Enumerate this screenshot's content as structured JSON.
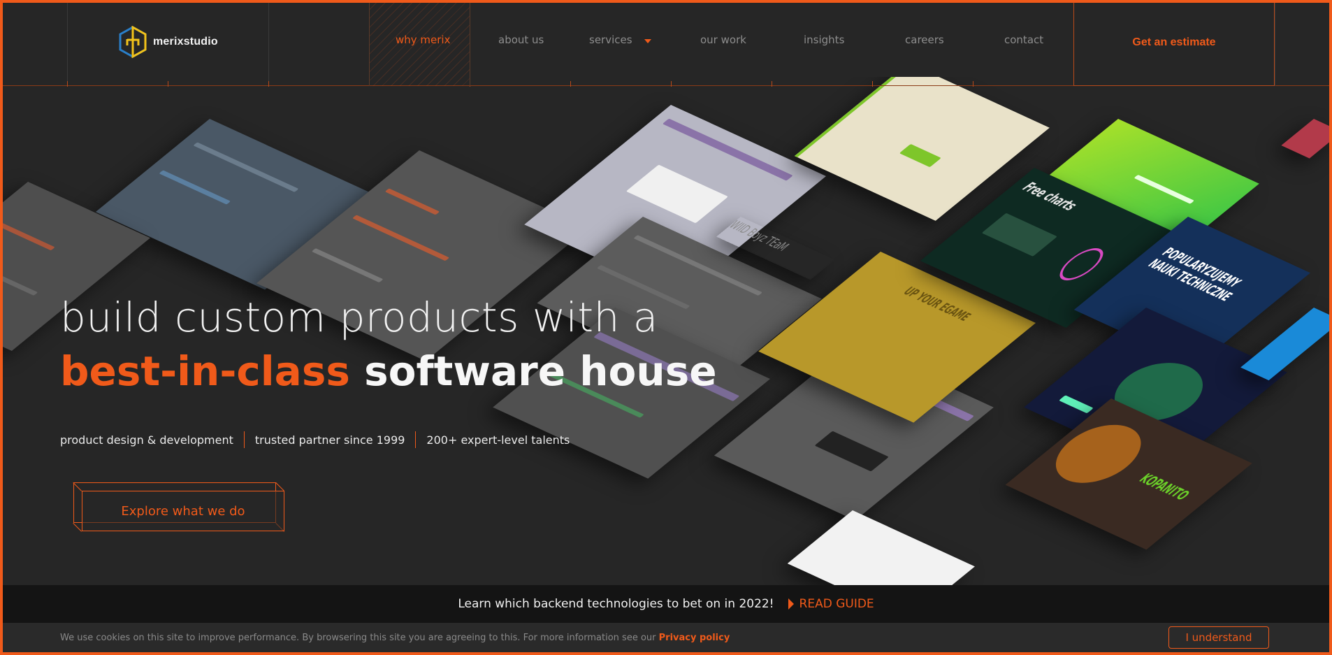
{
  "header": {
    "logo_text": "merixstudio",
    "nav": [
      {
        "label": "why merix",
        "active": true
      },
      {
        "label": "about us"
      },
      {
        "label": "services",
        "has_dropdown": true
      },
      {
        "label": "our work"
      },
      {
        "label": "insights"
      },
      {
        "label": "careers"
      },
      {
        "label": "contact"
      }
    ],
    "estimate_label": "Get an estimate"
  },
  "hero": {
    "line1": "build custom products with a",
    "line2_accent": "best-in-class",
    "line2_plain": "software house",
    "facts": [
      "product design & development",
      "trusted partner since 1999",
      "200+ expert-level talents"
    ],
    "cta_label": "Explore what we do",
    "collage_texts": {
      "charts_title": "Free charts",
      "poster_title": "POPULARYZUJEMY NAUKI TECHNICZNE",
      "egame_title": "UP YOUR EGAME",
      "team_title": "WIID Boyz TEaM",
      "game_title": "KOPANITO"
    }
  },
  "guide_banner": {
    "text": "Learn which backend technologies to bet on in 2022!",
    "link": "READ GUIDE"
  },
  "cookies": {
    "text": "We use cookies on this site to improve performance. By browsering this site you are agreeing to this. For more information see our",
    "link": "Privacy policy",
    "button": "I understand"
  },
  "colors": {
    "accent": "#f05a1a",
    "background": "#262626",
    "banner": "#141414"
  }
}
